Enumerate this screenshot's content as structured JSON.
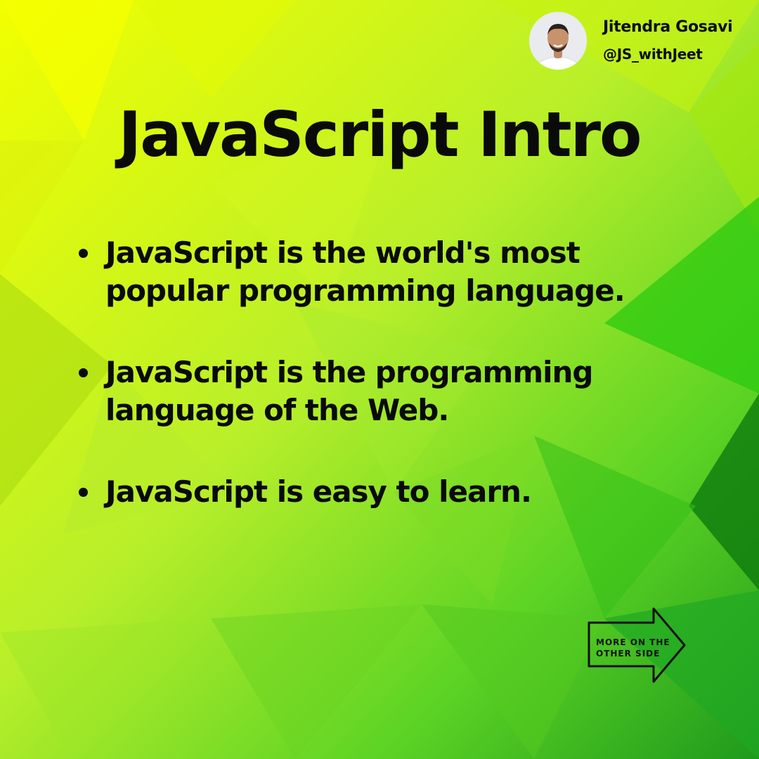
{
  "author": {
    "name": "Jitendra Gosavi",
    "handle": "@JS_withJeet"
  },
  "slide": {
    "title": "JavaScript Intro",
    "bullets": [
      "JavaScript is the world's most popular programming language.",
      "JavaScript is the programming language of the Web.",
      "JavaScript is easy to learn."
    ]
  },
  "next": {
    "line1": "MORE ON THE",
    "line2": "OTHER SIDE"
  },
  "colors": {
    "background_light": "#e6ff00",
    "background_dark": "#1f8a18",
    "text": "#0a0a0a"
  },
  "icons": {
    "avatar": "profile-photo",
    "next": "arrow-right-icon"
  }
}
